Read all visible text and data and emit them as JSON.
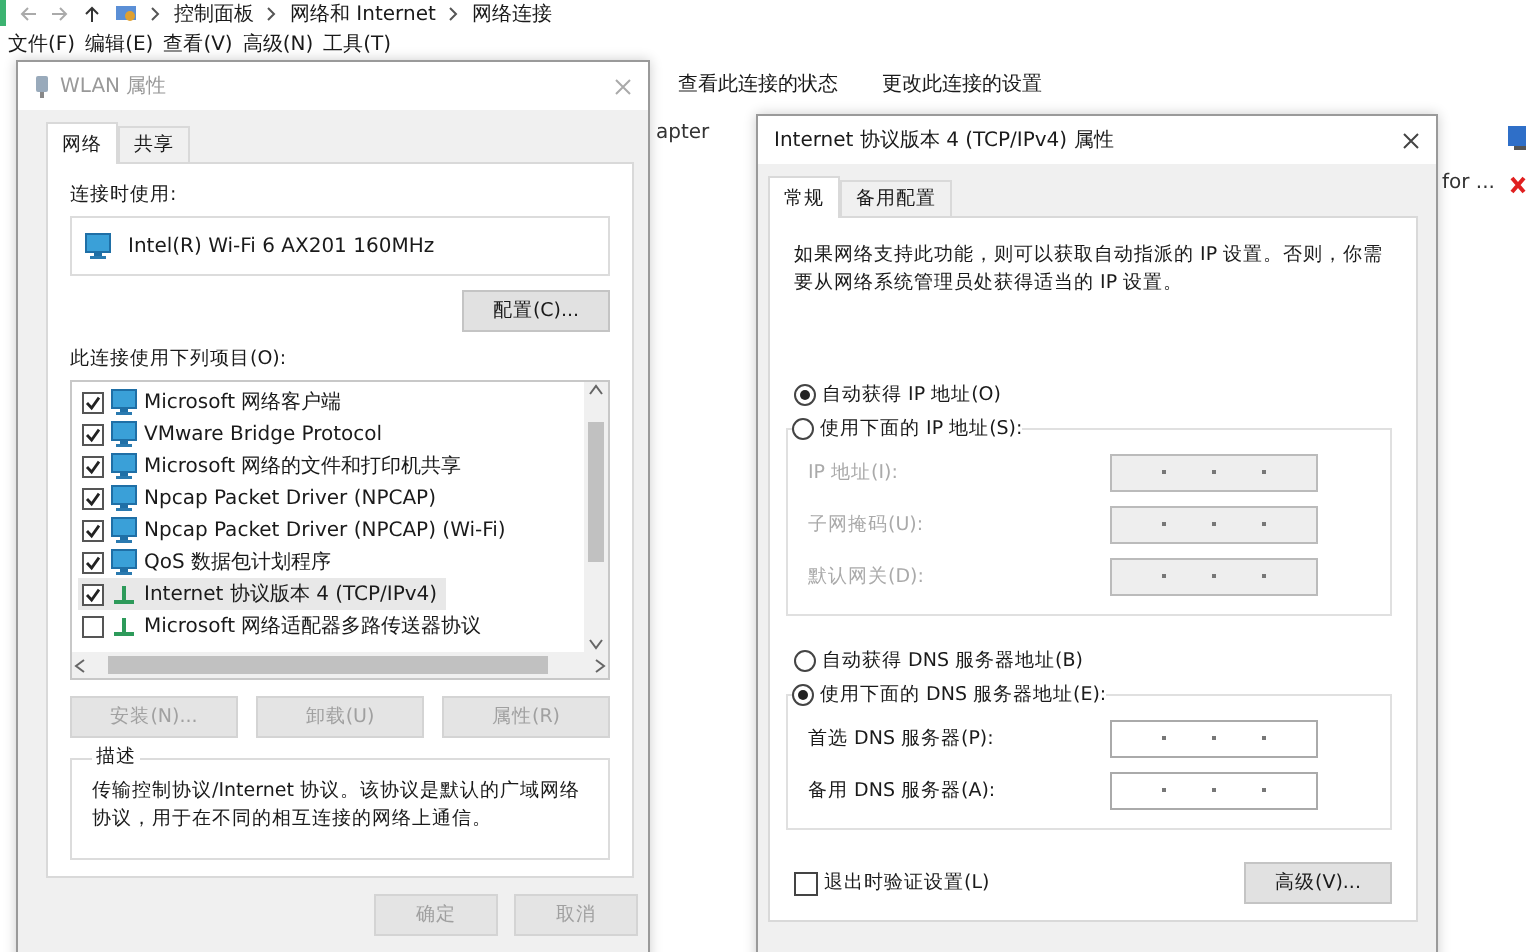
{
  "explorer": {
    "breadcrumb": [
      "控制面板",
      "网络和 Internet",
      "网络连接"
    ],
    "menu": [
      "文件(F)",
      "编辑(E)",
      "查看(V)",
      "高级(N)",
      "工具(T)"
    ],
    "toolbar": [
      "查看此连接的状态",
      "更改此连接的设置"
    ],
    "partial_texts": [
      "apter",
      "for ..."
    ]
  },
  "wlan_dialog": {
    "title": "WLAN 属性",
    "active": false,
    "tabs": [
      {
        "label": "网络",
        "selected": true
      },
      {
        "label": "共享",
        "selected": false
      }
    ],
    "connect_using_label": "连接时使用:",
    "adapter": "Intel(R) Wi-Fi 6 AX201 160MHz",
    "configure_button": "配置(C)...",
    "items_label": "此连接使用下列项目(O):",
    "items": [
      {
        "label": "Microsoft 网络客户端",
        "kind": "service",
        "checked": true,
        "selected": false
      },
      {
        "label": "VMware Bridge Protocol",
        "kind": "service",
        "checked": true,
        "selected": false
      },
      {
        "label": "Microsoft 网络的文件和打印机共享",
        "kind": "service",
        "checked": true,
        "selected": false
      },
      {
        "label": "Npcap Packet Driver (NPCAP)",
        "kind": "service",
        "checked": true,
        "selected": false
      },
      {
        "label": "Npcap Packet Driver (NPCAP) (Wi-Fi)",
        "kind": "service",
        "checked": true,
        "selected": false
      },
      {
        "label": "QoS 数据包计划程序",
        "kind": "service",
        "checked": true,
        "selected": false
      },
      {
        "label": "Internet 协议版本 4 (TCP/IPv4)",
        "kind": "protocol",
        "checked": true,
        "selected": true
      },
      {
        "label": "Microsoft 网络适配器多路传送器协议",
        "kind": "protocol",
        "checked": false,
        "selected": false
      }
    ],
    "buttons": [
      {
        "label": "安装(N)...",
        "disabled": true
      },
      {
        "label": "卸载(U)",
        "disabled": true
      },
      {
        "label": "属性(R)",
        "disabled": true
      }
    ],
    "description_label": "描述",
    "description": "传输控制协议/Internet 协议。该协议是默认的广域网络协议，用于在不同的相互连接的网络上通信。",
    "footer_buttons": [
      {
        "label": "确定",
        "disabled": true
      },
      {
        "label": "取消",
        "disabled": true
      }
    ]
  },
  "ipv4_dialog": {
    "title": "Internet 协议版本 4 (TCP/IPv4) 属性",
    "active": true,
    "tabs": [
      {
        "label": "常规",
        "selected": true
      },
      {
        "label": "备用配置",
        "selected": false
      }
    ],
    "intro": "如果网络支持此功能，则可以获取自动指派的 IP 设置。否则，你需要从网络系统管理员处获得适当的 IP 设置。",
    "ip_options": [
      {
        "label": "自动获得 IP 地址(O)",
        "selected": true
      },
      {
        "label": "使用下面的 IP 地址(S):",
        "selected": false
      }
    ],
    "ip_fields": [
      {
        "label": "IP 地址(I):",
        "disabled": true
      },
      {
        "label": "子网掩码(U):",
        "disabled": true
      },
      {
        "label": "默认网关(D):",
        "disabled": true
      }
    ],
    "dns_options": [
      {
        "label": "自动获得 DNS 服务器地址(B)",
        "selected": false
      },
      {
        "label": "使用下面的 DNS 服务器地址(E):",
        "selected": true
      }
    ],
    "dns_fields": [
      {
        "label": "首选 DNS 服务器(P):",
        "disabled": false
      },
      {
        "label": "备用 DNS 服务器(A):",
        "disabled": false
      }
    ],
    "validate": {
      "label": "退出时验证设置(L)",
      "checked": false
    },
    "advanced_button": "高级(V)..."
  }
}
